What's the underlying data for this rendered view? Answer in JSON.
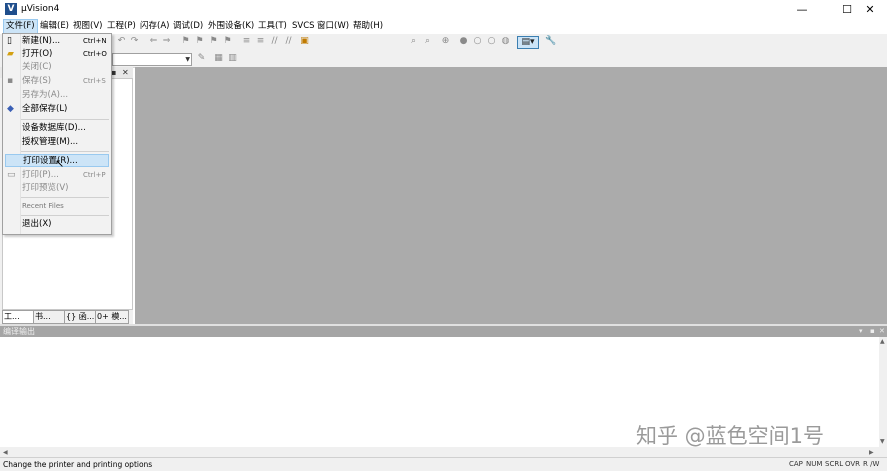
{
  "window": {
    "title": "µVision4",
    "minimize": "—",
    "maximize": "☐",
    "close": "✕"
  },
  "menubar": [
    "文件(F)",
    "编辑(E)",
    "视图(V)",
    "工程(P)",
    "闪存(A)",
    "调试(D)",
    "外围设备(K)",
    "工具(T)",
    "SVCS",
    "窗口(W)",
    "帮助(H)"
  ],
  "file_menu": {
    "items": [
      {
        "label": "新建(N)...",
        "shortcut": "Ctrl+N",
        "enabled": true,
        "icon": "new-file-icon"
      },
      {
        "label": "打开(O)",
        "shortcut": "Ctrl+O",
        "enabled": true,
        "icon": "open-folder-icon"
      },
      {
        "label": "关闭(C)",
        "shortcut": "",
        "enabled": false,
        "icon": ""
      },
      {
        "label": "保存(S)",
        "shortcut": "Ctrl+S",
        "enabled": false,
        "icon": "save-icon"
      },
      {
        "label": "另存为(A)...",
        "shortcut": "",
        "enabled": false,
        "icon": ""
      },
      {
        "label": "全部保存(L)",
        "shortcut": "",
        "enabled": true,
        "icon": "save-all-icon"
      },
      {
        "label": "设备数据库(D)...",
        "shortcut": "",
        "enabled": true,
        "icon": ""
      },
      {
        "label": "授权管理(M)...",
        "shortcut": "",
        "enabled": true,
        "icon": ""
      },
      {
        "label": "打印设置(R)...",
        "shortcut": "",
        "enabled": true,
        "icon": "",
        "highlighted": true
      },
      {
        "label": "打印(P)...",
        "shortcut": "Ctrl+P",
        "enabled": false,
        "icon": "print-icon"
      },
      {
        "label": "打印预览(V)",
        "shortcut": "",
        "enabled": false,
        "icon": ""
      },
      {
        "label": "Recent Files",
        "shortcut": "",
        "enabled": false,
        "icon": ""
      },
      {
        "label": "退出(X)",
        "shortcut": "",
        "enabled": true,
        "icon": ""
      }
    ]
  },
  "project_tabs": [
    "工...",
    "书...",
    "{} 函...",
    "0+ 模..."
  ],
  "build_output": {
    "title": "编译输出"
  },
  "status": {
    "text": "Change the printer and printing options",
    "indicators": [
      "CAP",
      "NUM",
      "SCRL",
      "OVR",
      "R /W"
    ]
  },
  "watermark": "知乎 @蓝色空间1号"
}
